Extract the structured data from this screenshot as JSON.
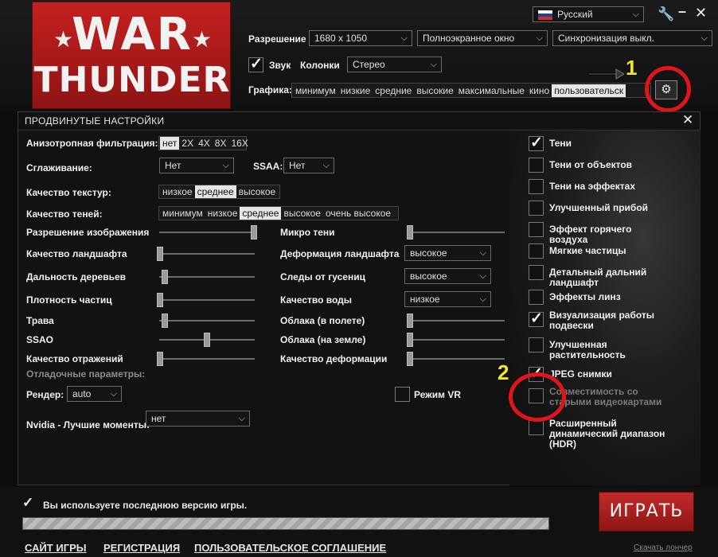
{
  "top": {
    "language": "Русский",
    "resolution_label": "Разрешение",
    "resolution_value": "1680 x 1050",
    "mode_value": "Полноэкранное окно",
    "sync_value": "Синхронизация выкл.",
    "sound_label": "Звук",
    "speakers_label": "Колонки",
    "speakers_value": "Стерео",
    "graphics_label": "Графика:",
    "graphics_presets": [
      "минимум",
      "низкие",
      "средние",
      "высокие",
      "максимальные",
      "кино",
      "пользовательск"
    ],
    "graphics_selected": "пользовательск",
    "logo_top": "WAR",
    "logo_bottom": "THUNDER",
    "annot_1": "1",
    "annot_2": "2"
  },
  "panel": {
    "title": "ПРОДВИНУТЫЕ НАСТРОЙКИ",
    "aniso_label": "Анизотропная фильтрация:",
    "aniso_options": [
      "нет",
      "2X",
      "4X",
      "8X",
      "16X"
    ],
    "aa_label": "Сглаживание:",
    "aa_value": "Нет",
    "ssaa_label": "SSAA:",
    "ssaa_value": "Нет",
    "tex_label": "Качество текстур:",
    "tex_options": [
      "низкое",
      "среднее",
      "высокое"
    ],
    "shadowq_label": "Качество теней:",
    "shadowq_options": [
      "минимум",
      "низкое",
      "среднее",
      "высокое",
      "очень высокое"
    ],
    "sliders_left": [
      {
        "label": "Разрешение изображения",
        "value": 1.0
      },
      {
        "label": "Качество ландшафта",
        "value": 0.0
      },
      {
        "label": "Дальность деревьев",
        "value": 0.05
      },
      {
        "label": "Плотность частиц",
        "value": 0.0
      },
      {
        "label": "Трава",
        "value": 0.05
      },
      {
        "label": "SSAO",
        "value": 0.5
      },
      {
        "label": "Качество отражений",
        "value": 0.0
      }
    ],
    "micro_label": "Микро тени",
    "micro_value": 0.0,
    "terrain_def_label": "Деформация ландшафта",
    "terrain_def_value": "высокое",
    "tracks_label": "Следы от гусениц",
    "tracks_value": "высокое",
    "water_label": "Качество воды",
    "water_value": "низкое",
    "clouds_flight_label": "Облака (в полете)",
    "clouds_flight_value": 0.0,
    "clouds_ground_label": "Облака (на земле)",
    "clouds_ground_value": 0.0,
    "deform_label": "Качество деформации",
    "deform_value": 0.0,
    "debug_label": "Отладочные параметры:",
    "render_label": "Рендер:",
    "render_value": "auto",
    "vr_label": "Режим VR",
    "nvidia_label": "Nvidia - Лучшие моменты:",
    "nvidia_value": "нет",
    "checks": [
      {
        "label": "Тени",
        "checked": true
      },
      {
        "label": "Тени от объектов",
        "checked": false
      },
      {
        "label": "Тени на эффектах",
        "checked": false
      },
      {
        "label": "Улучшенный прибой",
        "checked": false
      },
      {
        "label": "Эффект горячего воздуха",
        "checked": false
      },
      {
        "label": "Мягкие частицы",
        "checked": false
      },
      {
        "label": "Детальный дальний ландшафт",
        "checked": false
      },
      {
        "label": "Эффекты линз",
        "checked": false
      },
      {
        "label": "Визуализация работы подвески",
        "checked": true
      },
      {
        "label": "Улучшенная растительность",
        "checked": false
      },
      {
        "label": "JPEG снимки",
        "checked": true
      },
      {
        "label": "Совместимость со старыми видеокартами",
        "checked": false
      },
      {
        "label": "Расширенный динамический диапазон (HDR)",
        "checked": false
      }
    ]
  },
  "bottom": {
    "status": "Вы используете последнюю версию игры.",
    "progress": 1.0,
    "play": "ИГРАТЬ",
    "links": [
      "САЙТ ИГРЫ",
      "РЕГИСТРАЦИЯ",
      "ПОЛЬЗОВАТЕЛЬСКОЕ СОГЛАШЕНИЕ"
    ],
    "download": "Скачать лончер"
  },
  "colors": {
    "accent_red": "#b51f1f",
    "annotation_red": "#e0151c",
    "annotation_yellow": "#f3e42b"
  }
}
